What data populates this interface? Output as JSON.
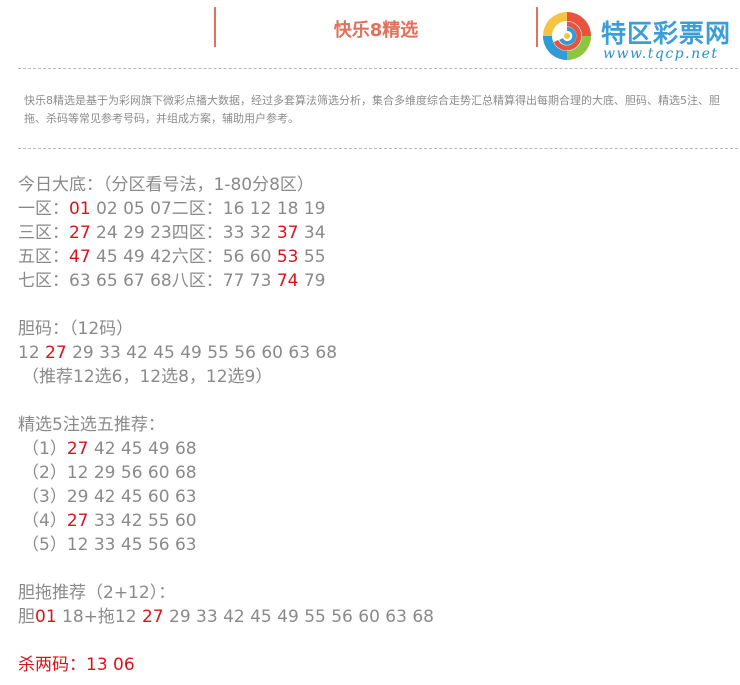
{
  "header": {
    "title": "快乐8精选"
  },
  "logo": {
    "name": "特区彩票网",
    "url": "www.tqcp.net"
  },
  "intro": {
    "text": "快乐8精选是基于为彩网旗下微彩点播大数据，经过多套算法筛选分析，集合多维度综合走势汇总精算得出每期合理的大底、胆码、精选5注、胆拖、杀码等常见参考号码，并组成方案，辅助用户参考。"
  },
  "colors": {
    "accent": "#e2705a",
    "highlight": "#d8141a",
    "text": "#8a8a8a",
    "brand": "#3a9fd8"
  },
  "dadi": {
    "heading": "今日大底：（分区看号法，1-80分8区）",
    "rows": [
      [
        {
          "text": "一区：",
          "red": false
        },
        {
          "text": "01",
          "red": true
        },
        {
          "text": " 02 05 07二区：16 12 18 19",
          "red": false
        }
      ],
      [
        {
          "text": "三区：",
          "red": false
        },
        {
          "text": "27",
          "red": true
        },
        {
          "text": " 24 29 23四区：33 32 ",
          "red": false
        },
        {
          "text": "37",
          "red": true
        },
        {
          "text": " 34",
          "red": false
        }
      ],
      [
        {
          "text": "五区：",
          "red": false
        },
        {
          "text": "47",
          "red": true
        },
        {
          "text": " 45 49 42六区：56 60 ",
          "red": false
        },
        {
          "text": "53",
          "red": true
        },
        {
          "text": " 55",
          "red": false
        }
      ],
      [
        {
          "text": "七区：63 65 67 68八区：77 73 ",
          "red": false
        },
        {
          "text": "74",
          "red": true
        },
        {
          "text": " 79",
          "red": false
        }
      ]
    ]
  },
  "danma": {
    "heading": "胆码：（12码）",
    "numbers": [
      {
        "text": "12 ",
        "red": false
      },
      {
        "text": "27",
        "red": true
      },
      {
        "text": " 29 33 42 45 49 55 56 60 63 68",
        "red": false
      }
    ],
    "note": "（推荐12选6，12选8，12选9）"
  },
  "jingxuan": {
    "heading": "精选5注选五推荐：",
    "rows": [
      [
        {
          "text": "（1）",
          "red": false
        },
        {
          "text": "27",
          "red": true
        },
        {
          "text": " 42 45 49 68",
          "red": false
        }
      ],
      [
        {
          "text": "（2）12 29 56 60 68",
          "red": false
        }
      ],
      [
        {
          "text": "（3）29 42 45 60 63",
          "red": false
        }
      ],
      [
        {
          "text": "（4）",
          "red": false
        },
        {
          "text": "27",
          "red": true
        },
        {
          "text": " 33 42 55 60",
          "red": false
        }
      ],
      [
        {
          "text": "（5）12 33 45 56 63",
          "red": false
        }
      ]
    ]
  },
  "dantuo": {
    "heading": "胆拖推荐（2+12）：",
    "line": [
      {
        "text": "胆",
        "red": false
      },
      {
        "text": "01",
        "red": true
      },
      {
        "text": " 18+拖12 ",
        "red": false
      },
      {
        "text": "27",
        "red": true
      },
      {
        "text": " 29 33 42 45 49 55 56 60 63 68",
        "red": false
      }
    ]
  },
  "shama": {
    "line": "杀两码：13 06"
  }
}
